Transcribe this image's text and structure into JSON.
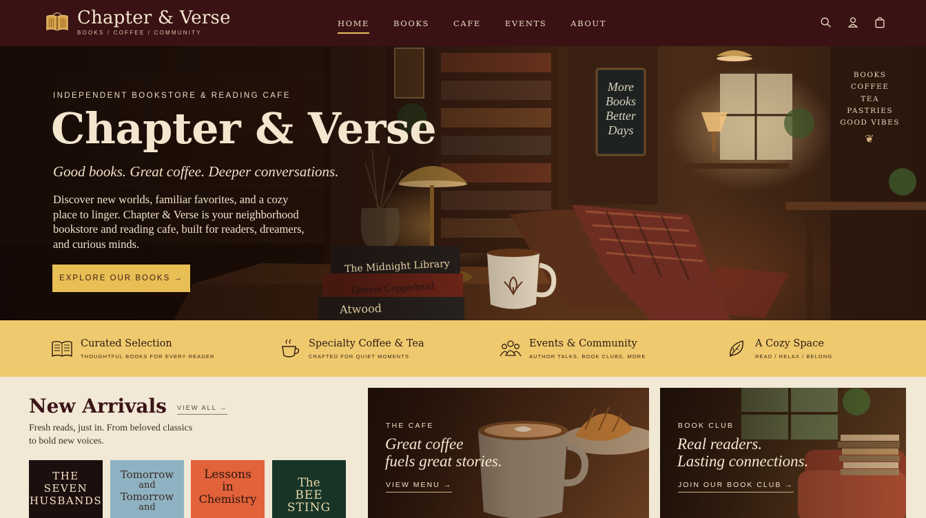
{
  "nav": {
    "logo_title": "Chapter & Verse",
    "logo_tagline": "BOOKS / COFFEE / COMMUNITY",
    "items": [
      {
        "label": "HOME",
        "active": true
      },
      {
        "label": "BOOKS",
        "active": false
      },
      {
        "label": "CAFE",
        "active": false
      },
      {
        "label": "EVENTS",
        "active": false
      },
      {
        "label": "ABOUT",
        "active": false
      }
    ],
    "icons": [
      "search-icon",
      "account-icon",
      "shopping-bag-icon"
    ]
  },
  "hero": {
    "eyebrow": "INDEPENDENT BOOKSTORE & READING CAFE",
    "title": "Chapter & Verse",
    "tagline": "Good books. Great coffee. Deeper conversations.",
    "description": "Discover new worlds, familiar favorites, and a cozy place to linger. Chapter & Verse is your neighborhood bookstore and reading cafe, built for readers, dreamers, and curious minds.",
    "button_label": "EXPLORE OUR BOOKS →",
    "chalkboard": "More Books Better Days",
    "side_list": [
      "BOOKS",
      "COFFEE",
      "TEA",
      "PASTRIES",
      "GOOD VIBES"
    ],
    "books_on_table": [
      "The Midnight Library",
      "Demon Copperhead",
      "Atwood"
    ]
  },
  "features": [
    {
      "title": "Curated Selection",
      "subtitle": "THOUGHTFUL BOOKS FOR EVERY READER",
      "icon": "open-book-icon"
    },
    {
      "title": "Specialty Coffee & Tea",
      "subtitle": "CRAFTED FOR QUIET MOMENTS",
      "icon": "coffee-cup-icon"
    },
    {
      "title": "Events & Community",
      "subtitle": "AUTHOR TALKS, BOOK CLUBS, MORE",
      "icon": "people-icon"
    },
    {
      "title": "A Cozy Space",
      "subtitle": "READ / RELAX / BELONG",
      "icon": "leaf-icon"
    }
  ],
  "arrivals": {
    "title": "New Arrivals",
    "view_all": "VIEW ALL →",
    "description": "Fresh reads, just in. From beloved classics to bold new voices.",
    "books": [
      {
        "title_lines": [
          "THE",
          "SEVEN",
          "HUSBANDS"
        ],
        "bg": "#1d0f0d",
        "fg": "#f1e3c8"
      },
      {
        "title_lines": [
          "Tomorrow",
          "and",
          "Tomorrow",
          "and"
        ],
        "bg": "#8fb2c2",
        "fg": "#3a2a25"
      },
      {
        "title_lines": [
          "Lessons",
          "in",
          "Chemistry"
        ],
        "bg": "#e2623a",
        "fg": "#2a1410"
      },
      {
        "title_lines": [
          "The",
          "BEE STING"
        ],
        "bg": "#173427",
        "fg": "#e9d7a8"
      }
    ]
  },
  "cards": [
    {
      "eyebrow": "THE CAFE",
      "title_line1": "Great coffee",
      "title_line2": "fuels great stories.",
      "link": "VIEW MENU →"
    },
    {
      "eyebrow": "BOOK CLUB",
      "title_line1": "Real readers.",
      "title_line2": "Lasting connections.",
      "link": "JOIN OUR BOOK CLUB →"
    }
  ],
  "colors": {
    "nav_bg": "#3a1213",
    "accent_gold": "#e8bf55",
    "band_bg": "#efc96d",
    "page_bg": "#f1e8d6",
    "heading_maroon": "#3a1416"
  }
}
